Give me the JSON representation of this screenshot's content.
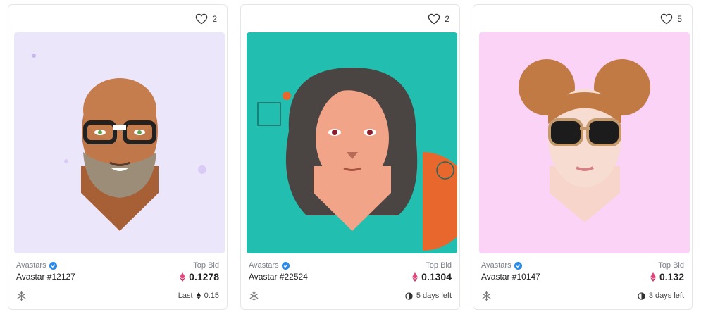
{
  "colors": {
    "verified": "#2b8ae8",
    "eth_pink": "#e0457b",
    "eth_dark": "#222222"
  },
  "cards": [
    {
      "likes": "2",
      "collection": "Avastars",
      "name": "Avastar #12127",
      "bid_label": "Top Bid",
      "bid": "0.1278",
      "status_prefix": "Last",
      "status_value": "0.15",
      "status_icon": "ethereum-icon",
      "bg": "#ece6fb"
    },
    {
      "likes": "2",
      "collection": "Avastars",
      "name": "Avastar #22524",
      "bid_label": "Top Bid",
      "bid": "0.1304",
      "status_value": "5 days left",
      "status_icon": "clock-icon",
      "bg": "#22bfb0"
    },
    {
      "likes": "5",
      "collection": "Avastars",
      "name": "Avastar #10147",
      "bid_label": "Top Bid",
      "bid": "0.132",
      "status_value": "3 days left",
      "status_icon": "clock-icon",
      "bg": "#fbd3f7"
    }
  ]
}
